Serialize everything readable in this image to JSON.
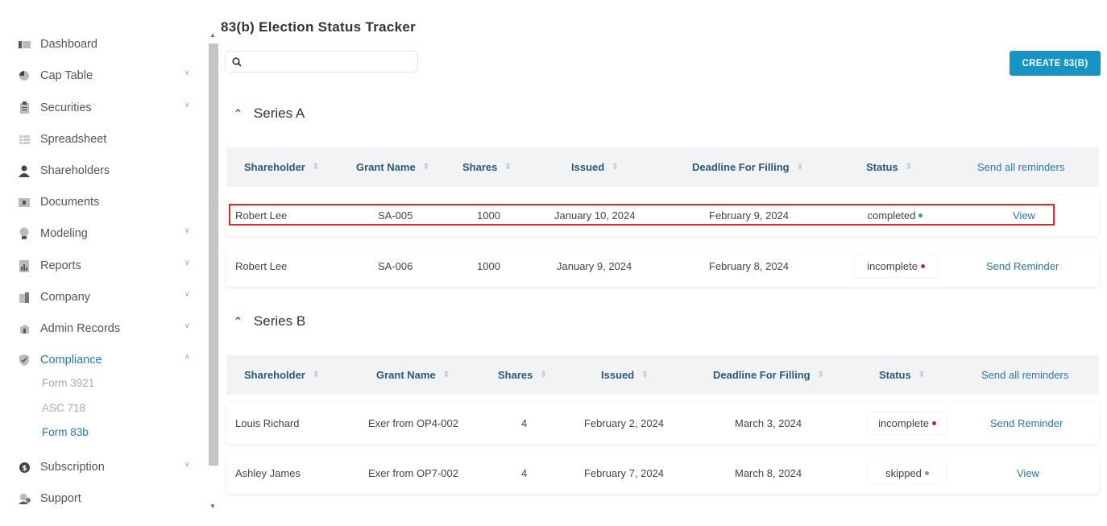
{
  "sidebar": {
    "items": [
      {
        "label": "Dashboard",
        "icon": "dashboard-icon"
      },
      {
        "label": "Cap Table",
        "icon": "pie-chart-icon"
      },
      {
        "label": "Securities",
        "icon": "clipboard-icon"
      },
      {
        "label": "Spreadsheet",
        "icon": "spreadsheet-icon"
      },
      {
        "label": "Shareholders",
        "icon": "person-icon"
      },
      {
        "label": "Documents",
        "icon": "folder-icon"
      },
      {
        "label": "Modeling",
        "icon": "lightbulb-icon"
      },
      {
        "label": "Reports",
        "icon": "report-icon"
      },
      {
        "label": "Company",
        "icon": "building-icon"
      },
      {
        "label": "Admin Records",
        "icon": "admin-records-icon"
      },
      {
        "label": "Compliance",
        "icon": "shield-icon"
      },
      {
        "label": "Subscription",
        "icon": "dollar-icon"
      },
      {
        "label": "Support",
        "icon": "support-icon"
      }
    ],
    "compliance_sub": [
      "Form 3921",
      "ASC 718",
      "Form 83b"
    ]
  },
  "page": {
    "title": "83(b) Election Status Tracker",
    "search_value": "",
    "create_button": "CREATE 83(B)"
  },
  "columns": {
    "shareholder": "Shareholder",
    "grant_name": "Grant Name",
    "shares": "Shares",
    "issued": "Issued",
    "deadline": "Deadline For Filling",
    "status": "Status",
    "reminders": "Send all reminders"
  },
  "sections": [
    {
      "name": "Series A",
      "rows": [
        {
          "shareholder": "Robert Lee",
          "grant_name": "SA-005",
          "shares": "1000",
          "issued": "January 10, 2024",
          "deadline": "February 9, 2024",
          "status": "completed",
          "action": "View"
        },
        {
          "shareholder": "Robert Lee",
          "grant_name": "SA-006",
          "shares": "1000",
          "issued": "January 9, 2024",
          "deadline": "February 8, 2024",
          "status": "incomplete",
          "action": "Send Reminder"
        }
      ]
    },
    {
      "name": "Series B",
      "rows": [
        {
          "shareholder": "Louis Richard",
          "grant_name": "Exer from OP4-002",
          "shares": "4",
          "issued": "February 2, 2024",
          "deadline": "March 3, 2024",
          "status": "incomplete",
          "action": "Send Reminder"
        },
        {
          "shareholder": "Ashley James",
          "grant_name": "Exer from OP7-002",
          "shares": "4",
          "issued": "February 7, 2024",
          "deadline": "March 8, 2024",
          "status": "skipped",
          "action": "View"
        }
      ]
    }
  ],
  "colors": {
    "accent": "#1794c6",
    "link": "#2a78a8",
    "completed": "#3aa876",
    "incomplete": "#c0262c",
    "skipped": "#8a96a3",
    "highlight": "#e0252b"
  }
}
